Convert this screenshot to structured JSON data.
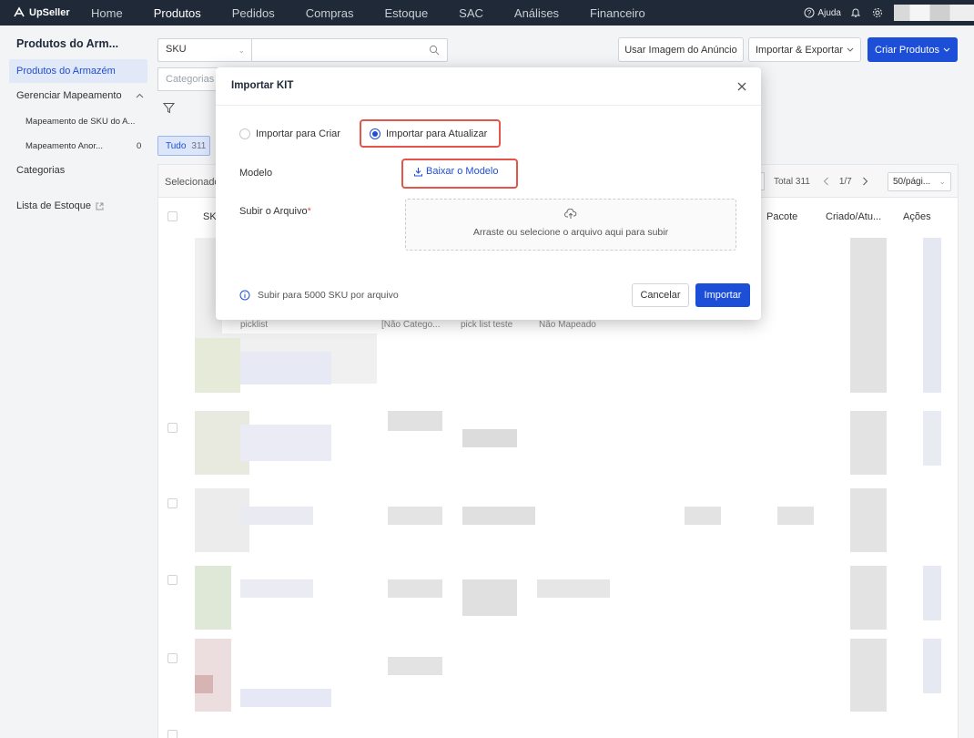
{
  "nav": {
    "brand": "UpSeller",
    "items": [
      "Home",
      "Produtos",
      "Pedidos",
      "Compras",
      "Estoque",
      "SAC",
      "Análises",
      "Financeiro"
    ],
    "active": "Produtos",
    "help_label": "Ajuda"
  },
  "sidebar": {
    "title": "Produtos do Arm...",
    "items": [
      {
        "label": "Produtos do Armazém",
        "active": true
      },
      {
        "label": "Gerenciar Mapeamento"
      }
    ],
    "subitems": [
      {
        "label": "Mapeamento de SKU do A..."
      },
      {
        "label": "Mapeamento Anor...",
        "count": "0"
      }
    ],
    "categories": "Categorias",
    "stock_list": "Lista de Estoque"
  },
  "toolbar": {
    "sku_select": "SKU",
    "search_placeholder": "",
    "use_image_label": "Usar Imagem do Anúncio",
    "import_export_label": "Importar & Exportar",
    "create_label": "Criar Produtos",
    "categories_placeholder": "Categorias"
  },
  "tabs": {
    "all_label": "Tudo",
    "all_count": "311"
  },
  "table": {
    "selected_label": "Selecionado",
    "total_label": "Total 311",
    "page_label": "1/7",
    "page_size": "50/pági...",
    "headers": {
      "sku": "SK",
      "pacote": "Pacote",
      "criado": "Criado/Atu...",
      "acoes": "Ações"
    },
    "partial_row": [
      "picklist",
      "[Não Catego...",
      "pick list teste",
      "Não Mapeado"
    ]
  },
  "modal": {
    "title": "Importar KIT",
    "radio_create": "Importar para Criar",
    "radio_update": "Importar para Atualizar",
    "selected": "update",
    "model_label": "Modelo",
    "download_label": "Baixar o Modelo",
    "upload_label": "Subir o Arquivo",
    "required_mark": "*",
    "dropzone_text": "Arraste ou selecione o arquivo aqui para subir",
    "hint": "Subir para 5000 SKU por arquivo",
    "cancel_label": "Cancelar",
    "import_label": "Importar"
  },
  "colors": {
    "nav_bg": "#1f2937",
    "primary": "#1d4ed8",
    "highlight": "#e5534b"
  }
}
